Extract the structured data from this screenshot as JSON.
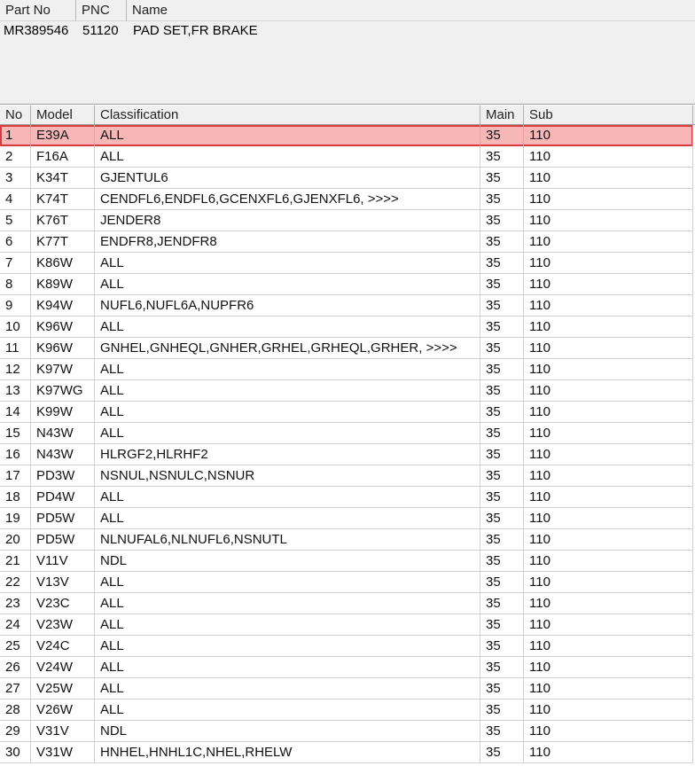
{
  "part_panel": {
    "columns": [
      "Part No",
      "PNC",
      "Name"
    ],
    "part_no": "MR389546",
    "pnc": "51120",
    "name": "PAD SET,FR BRAKE"
  },
  "grid": {
    "columns": [
      "No",
      "Model",
      "Classification",
      "Main",
      "Sub"
    ],
    "selected_row": 1,
    "rows": [
      {
        "no": "1",
        "model": "E39A",
        "classification": "ALL",
        "main": "35",
        "sub": "110"
      },
      {
        "no": "2",
        "model": "F16A",
        "classification": "ALL",
        "main": "35",
        "sub": "110"
      },
      {
        "no": "3",
        "model": "K34T",
        "classification": "GJENTUL6",
        "main": "35",
        "sub": "110"
      },
      {
        "no": "4",
        "model": "K74T",
        "classification": "CENDFL6,ENDFL6,GCENXFL6,GJENXFL6,  >>>>",
        "main": "35",
        "sub": "110"
      },
      {
        "no": "5",
        "model": "K76T",
        "classification": "JENDER8",
        "main": "35",
        "sub": "110"
      },
      {
        "no": "6",
        "model": "K77T",
        "classification": "ENDFR8,JENDFR8",
        "main": "35",
        "sub": "110"
      },
      {
        "no": "7",
        "model": "K86W",
        "classification": "ALL",
        "main": "35",
        "sub": "110"
      },
      {
        "no": "8",
        "model": "K89W",
        "classification": "ALL",
        "main": "35",
        "sub": "110"
      },
      {
        "no": "9",
        "model": "K94W",
        "classification": "NUFL6,NUFL6A,NUPFR6",
        "main": "35",
        "sub": "110"
      },
      {
        "no": "10",
        "model": "K96W",
        "classification": "ALL",
        "main": "35",
        "sub": "110"
      },
      {
        "no": "11",
        "model": "K96W",
        "classification": "GNHEL,GNHEQL,GNHER,GRHEL,GRHEQL,GRHER,  >>>>",
        "main": "35",
        "sub": "110"
      },
      {
        "no": "12",
        "model": "K97W",
        "classification": "ALL",
        "main": "35",
        "sub": "110"
      },
      {
        "no": "13",
        "model": "K97WG",
        "classification": "ALL",
        "main": "35",
        "sub": "110"
      },
      {
        "no": "14",
        "model": "K99W",
        "classification": "ALL",
        "main": "35",
        "sub": "110"
      },
      {
        "no": "15",
        "model": "N43W",
        "classification": "ALL",
        "main": "35",
        "sub": "110"
      },
      {
        "no": "16",
        "model": "N43W",
        "classification": "HLRGF2,HLRHF2",
        "main": "35",
        "sub": "110"
      },
      {
        "no": "17",
        "model": "PD3W",
        "classification": "NSNUL,NSNULC,NSNUR",
        "main": "35",
        "sub": "110"
      },
      {
        "no": "18",
        "model": "PD4W",
        "classification": "ALL",
        "main": "35",
        "sub": "110"
      },
      {
        "no": "19",
        "model": "PD5W",
        "classification": "ALL",
        "main": "35",
        "sub": "110"
      },
      {
        "no": "20",
        "model": "PD5W",
        "classification": "NLNUFAL6,NLNUFL6,NSNUTL",
        "main": "35",
        "sub": "110"
      },
      {
        "no": "21",
        "model": "V11V",
        "classification": "NDL",
        "main": "35",
        "sub": "110"
      },
      {
        "no": "22",
        "model": "V13V",
        "classification": "ALL",
        "main": "35",
        "sub": "110"
      },
      {
        "no": "23",
        "model": "V23C",
        "classification": "ALL",
        "main": "35",
        "sub": "110"
      },
      {
        "no": "24",
        "model": "V23W",
        "classification": "ALL",
        "main": "35",
        "sub": "110"
      },
      {
        "no": "25",
        "model": "V24C",
        "classification": "ALL",
        "main": "35",
        "sub": "110"
      },
      {
        "no": "26",
        "model": "V24W",
        "classification": "ALL",
        "main": "35",
        "sub": "110"
      },
      {
        "no": "27",
        "model": "V25W",
        "classification": "ALL",
        "main": "35",
        "sub": "110"
      },
      {
        "no": "28",
        "model": "V26W",
        "classification": "ALL",
        "main": "35",
        "sub": "110"
      },
      {
        "no": "29",
        "model": "V31V",
        "classification": "NDL",
        "main": "35",
        "sub": "110"
      },
      {
        "no": "30",
        "model": "V31W",
        "classification": "HNHEL,HNHL1C,NHEL,RHELW",
        "main": "35",
        "sub": "110"
      }
    ]
  },
  "colors": {
    "selected_fill": "#f7b7b7",
    "selected_border": "#d93a3a",
    "header_bg": "#f0f0f0"
  }
}
